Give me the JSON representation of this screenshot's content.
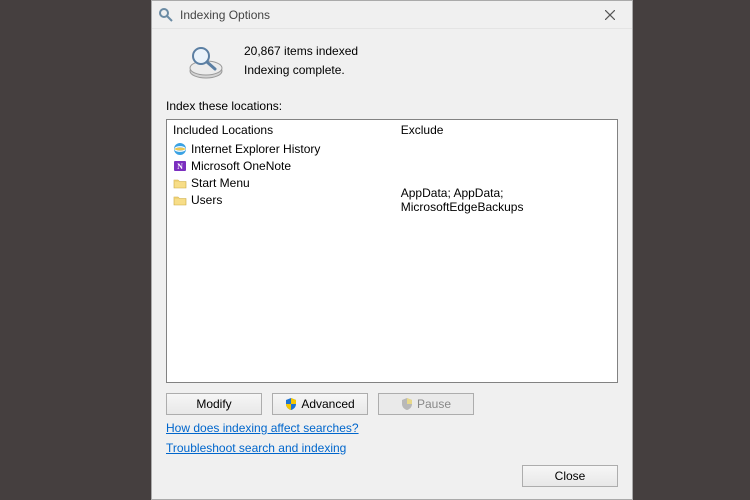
{
  "window": {
    "title": "Indexing Options"
  },
  "status": {
    "count_text": "20,867 items indexed",
    "state_text": "Indexing complete."
  },
  "section_label": "Index these locations:",
  "columns": {
    "included": "Included Locations",
    "exclude": "Exclude"
  },
  "locations": [
    {
      "icon": "ie",
      "name": "Internet Explorer History",
      "exclude": ""
    },
    {
      "icon": "onenote",
      "name": "Microsoft OneNote",
      "exclude": ""
    },
    {
      "icon": "folder",
      "name": "Start Menu",
      "exclude": ""
    },
    {
      "icon": "folder",
      "name": "Users",
      "exclude": "AppData; AppData; MicrosoftEdgeBackups"
    }
  ],
  "buttons": {
    "modify": "Modify",
    "advanced": "Advanced",
    "pause": "Pause",
    "close": "Close"
  },
  "links": {
    "how": "How does indexing affect searches?",
    "troubleshoot": "Troubleshoot search and indexing"
  }
}
